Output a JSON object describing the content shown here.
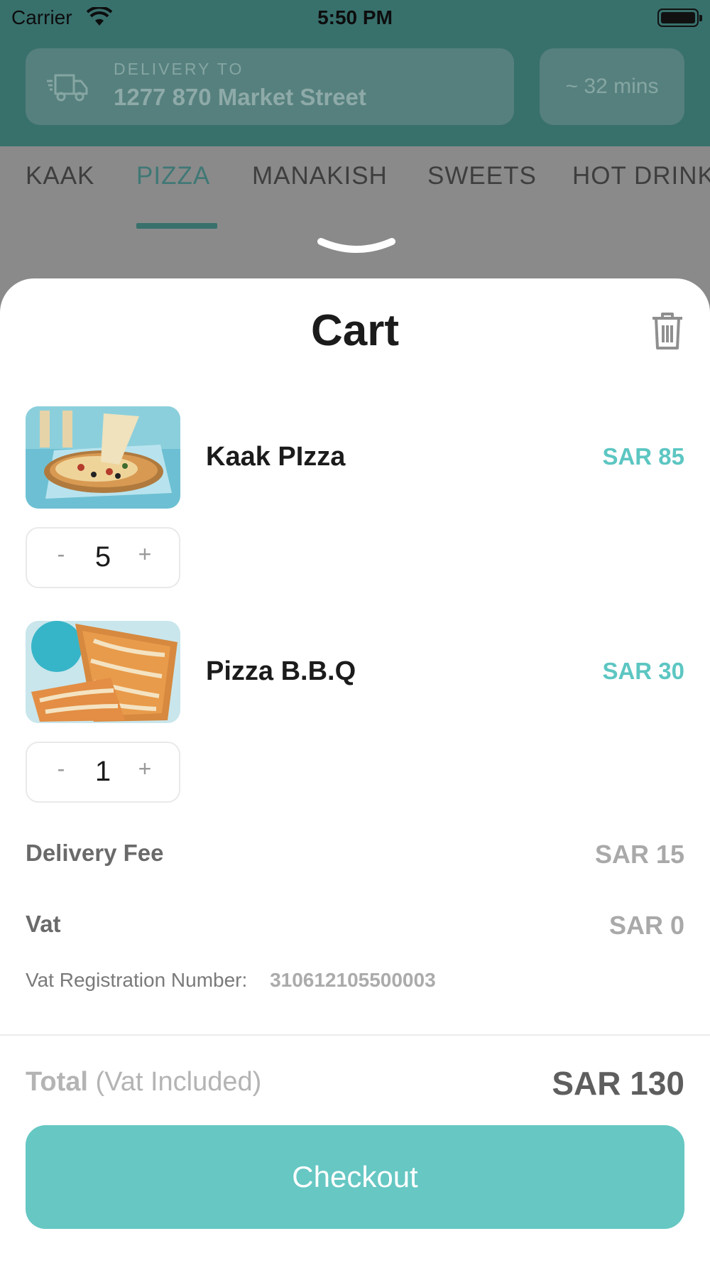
{
  "status_bar": {
    "carrier": "Carrier",
    "time": "5:50 PM"
  },
  "header": {
    "delivery_label": "DELIVERY TO",
    "delivery_address": "1277 870 Market Street",
    "eta": "~ 32 mins"
  },
  "categories": {
    "tabs": [
      "KAAK",
      "PIZZA",
      "MANAKISH",
      "SWEETS",
      "HOT DRINK"
    ],
    "active": "PIZZA"
  },
  "cart": {
    "title": "Cart",
    "items": [
      {
        "name": "Kaak PIzza",
        "price": "SAR 85",
        "quantity": "5",
        "minus": "-",
        "plus": "+"
      },
      {
        "name": "Pizza B.B.Q",
        "price": "SAR 30",
        "quantity": "1",
        "minus": "-",
        "plus": "+"
      }
    ],
    "delivery_fee_label": "Delivery Fee",
    "delivery_fee_value": "SAR 15",
    "vat_label": "Vat",
    "vat_value": "SAR 0",
    "vat_reg_label": "Vat Registration Number:",
    "vat_reg_number": "310612105500003",
    "total_label": "Total",
    "total_note": "(Vat Included)",
    "total_value": "SAR 130",
    "checkout_label": "Checkout"
  },
  "colors": {
    "accent": "#66c7c3",
    "price": "#5cc6c2",
    "header_dimmed": "#38706c"
  }
}
